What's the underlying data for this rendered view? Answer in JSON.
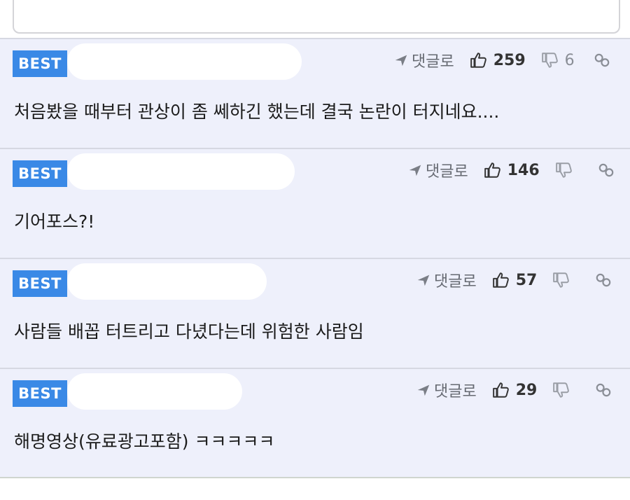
{
  "comments": [
    {
      "badge": "BEST",
      "reply_label": "댓글로",
      "likes": "259",
      "dislikes": "6",
      "text": "처음봤을 때부터 관상이 좀 쎄하긴 했는데 결국 논란이 터지네요...."
    },
    {
      "badge": "BEST",
      "reply_label": "댓글로",
      "likes": "146",
      "dislikes": "",
      "text": "기어포스?!"
    },
    {
      "badge": "BEST",
      "reply_label": "댓글로",
      "likes": "57",
      "dislikes": "",
      "text": "사람들 배꼽 터트리고 다녔다는데 위험한 사람임"
    },
    {
      "badge": "BEST",
      "reply_label": "댓글로",
      "likes": "29",
      "dislikes": "",
      "text": "해명영상(유료광고포함) ㅋㅋㅋㅋㅋ"
    }
  ],
  "icons": {
    "reply": "reply-arrow-icon",
    "like": "thumbs-up-icon",
    "dislike": "thumbs-down-icon",
    "link": "link-icon"
  },
  "colors": {
    "badge": "#3a89e6",
    "row_background": "#eef0fb",
    "text": "#1b1b1b",
    "muted": "#666a72"
  }
}
